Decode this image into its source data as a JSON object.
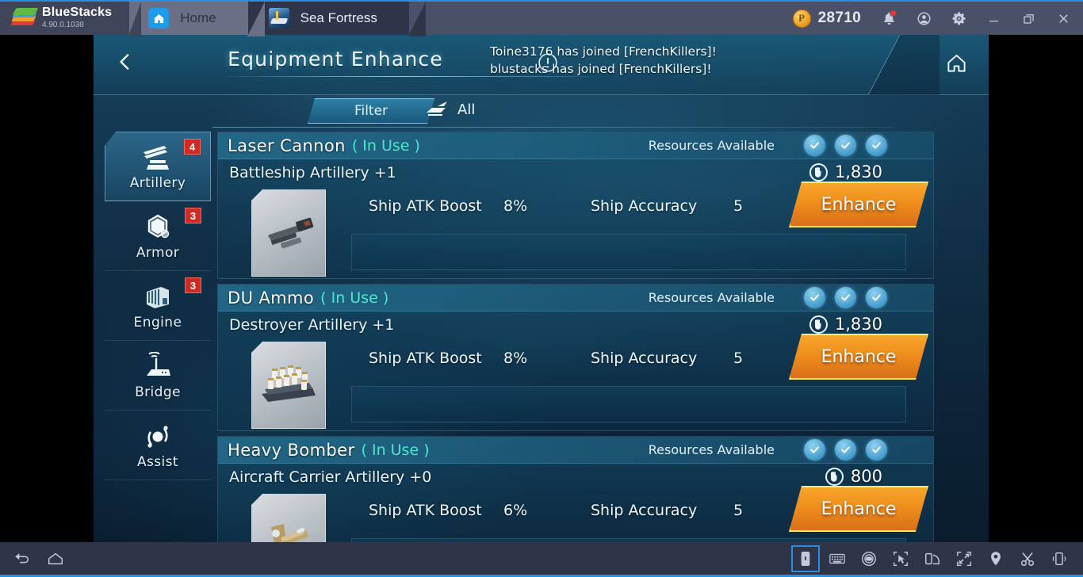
{
  "titlebar": {
    "app_name": "BlueStacks",
    "version": "4.90.0.1038",
    "tabs": [
      {
        "label": "Home",
        "icon": "home-icon"
      },
      {
        "label": "Sea Fortress",
        "icon": "game-icon"
      }
    ],
    "points": "28710",
    "point_icon": "coin-icon",
    "buttons": [
      "notifications-icon",
      "account-icon",
      "settings-icon",
      "minimize-icon",
      "restore-icon",
      "close-icon"
    ]
  },
  "game": {
    "header": {
      "back": "back-arrow-icon",
      "title": "Equipment Enhance",
      "info": "info-icon",
      "home": "home-icon",
      "news": [
        "Toine3176 has joined [FrenchKillers]!",
        "blustacks has joined [FrenchKillers]!"
      ]
    },
    "filter": {
      "button_label": "Filter",
      "chip_label": "All",
      "chip_icon": "ship-filter-icon"
    },
    "sidebar": [
      {
        "label": "Artillery",
        "badge": "4",
        "icon": "artillery-icon",
        "active": true
      },
      {
        "label": "Armor",
        "badge": "3",
        "icon": "armor-icon",
        "active": false
      },
      {
        "label": "Engine",
        "badge": "3",
        "icon": "engine-icon",
        "active": false
      },
      {
        "label": "Bridge",
        "badge": "",
        "icon": "bridge-icon",
        "active": false
      },
      {
        "label": "Assist",
        "badge": "",
        "icon": "assist-icon",
        "active": false
      }
    ],
    "common": {
      "resources_available": "Resources Available",
      "enhance_label": "Enhance",
      "in_use_label": "( In Use )",
      "stat1_label": "Ship ATK Boost",
      "stat2_label": "Ship Accuracy",
      "check_icon": "check-circle-icon",
      "cost_icon": "resource-icon"
    },
    "cards": [
      {
        "name": "Laser Cannon",
        "status": "( In Use )",
        "subtitle": "Battleship Artillery +1",
        "cost": "1,830",
        "stat1_label": "Ship ATK Boost",
        "stat1_value": "8%",
        "stat2_label": "Ship Accuracy",
        "stat2_value": "5",
        "checks": 3,
        "thumb": "laser-cannon-thumb",
        "enhance": "Enhance"
      },
      {
        "name": "DU Ammo",
        "status": "( In Use )",
        "subtitle": "Destroyer Artillery +1",
        "cost": "1,830",
        "stat1_label": "Ship ATK Boost",
        "stat1_value": "8%",
        "stat2_label": "Ship Accuracy",
        "stat2_value": "5",
        "checks": 3,
        "thumb": "du-ammo-thumb",
        "enhance": "Enhance"
      },
      {
        "name": "Heavy Bomber",
        "status": "( In Use )",
        "subtitle": "Aircraft Carrier Artillery +0",
        "cost": "800",
        "stat1_label": "Ship ATK Boost",
        "stat1_value": "6%",
        "stat2_label": "Ship Accuracy",
        "stat2_value": "5",
        "checks": 3,
        "thumb": "heavy-bomber-thumb",
        "enhance": "Enhance"
      }
    ]
  },
  "bottombar": {
    "left": [
      "back-icon",
      "home-icon"
    ],
    "right": [
      "portrait-mode-icon",
      "keyboard-icon",
      "eye-icon",
      "pointer-select-icon",
      "rotate-screen-icon",
      "fullscreen-icon",
      "location-icon",
      "scissors-icon",
      "shake-icon"
    ]
  },
  "colors": {
    "accent_blue": "#2a8fe0",
    "enhance_orange": "#ef8e1d",
    "badge_red": "#cf2a23",
    "in_use_teal": "#49e8cf"
  }
}
